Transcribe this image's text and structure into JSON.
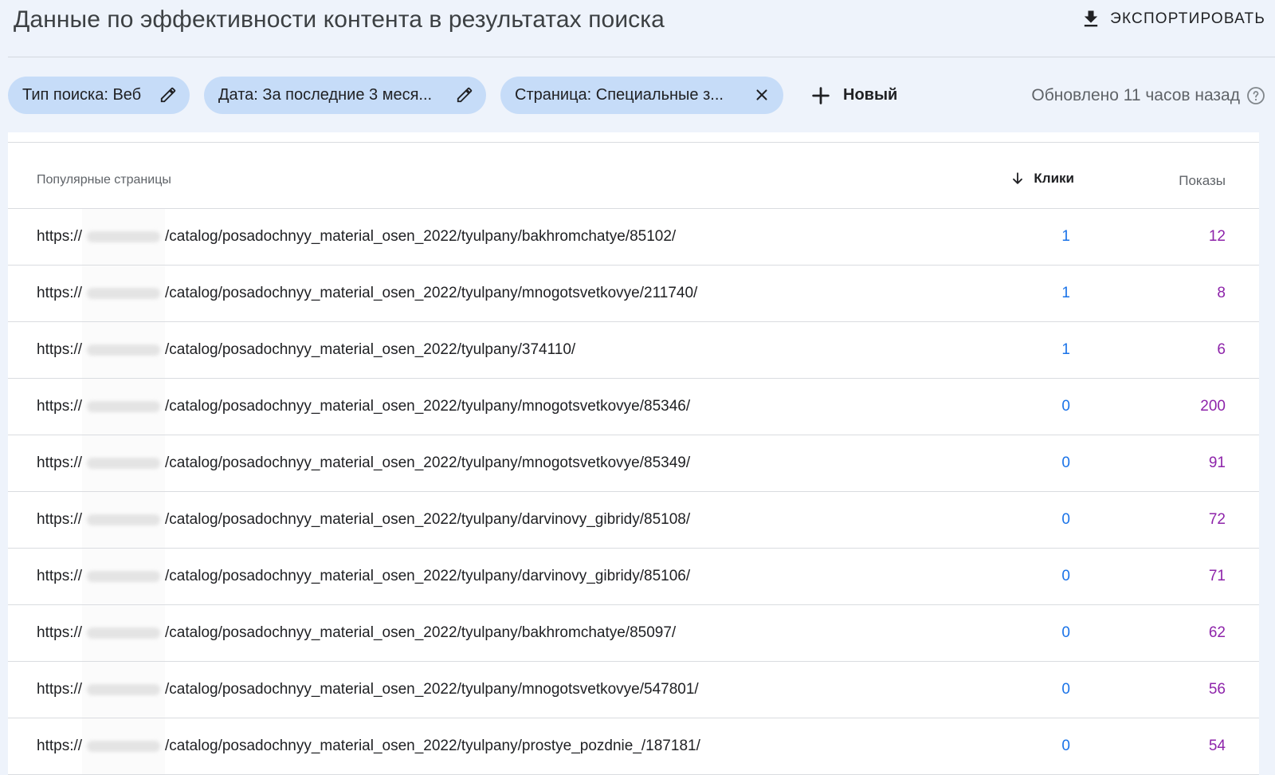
{
  "header": {
    "title": "Данные по эффективности контента в результатах поиска",
    "export_label": "ЭКСПОРТИРОВАТЬ"
  },
  "filters": {
    "chips": [
      {
        "label": "Тип поиска: Веб",
        "icon": "pencil-icon"
      },
      {
        "label": "Дата: За последние 3 меся...",
        "icon": "pencil-icon"
      },
      {
        "label": "Страница: Специальные з...",
        "icon": "close-icon"
      }
    ],
    "new_label": "Новый",
    "updated_text": "Обновлено 11 часов назад"
  },
  "table": {
    "headers": {
      "page": "Популярные страницы",
      "clicks": "Клики",
      "impressions": "Показы"
    },
    "rows": [
      {
        "prefix": "https://",
        "path": "/catalog/posadochnyy_material_osen_2022/tyulpany/bakhromchatye/85102/",
        "clicks": "1",
        "impressions": "12"
      },
      {
        "prefix": "https://",
        "path": "/catalog/posadochnyy_material_osen_2022/tyulpany/mnogotsvetkovye/211740/",
        "clicks": "1",
        "impressions": "8"
      },
      {
        "prefix": "https://",
        "path": "/catalog/posadochnyy_material_osen_2022/tyulpany/374110/",
        "clicks": "1",
        "impressions": "6"
      },
      {
        "prefix": "https://",
        "path": "/catalog/posadochnyy_material_osen_2022/tyulpany/mnogotsvetkovye/85346/",
        "clicks": "0",
        "impressions": "200"
      },
      {
        "prefix": "https://",
        "path": "/catalog/posadochnyy_material_osen_2022/tyulpany/mnogotsvetkovye/85349/",
        "clicks": "0",
        "impressions": "91"
      },
      {
        "prefix": "https://",
        "path": "/catalog/posadochnyy_material_osen_2022/tyulpany/darvinovy_gibridy/85108/",
        "clicks": "0",
        "impressions": "72"
      },
      {
        "prefix": "https://",
        "path": "/catalog/posadochnyy_material_osen_2022/tyulpany/darvinovy_gibridy/85106/",
        "clicks": "0",
        "impressions": "71"
      },
      {
        "prefix": "https://",
        "path": "/catalog/posadochnyy_material_osen_2022/tyulpany/bakhromchatye/85097/",
        "clicks": "0",
        "impressions": "62"
      },
      {
        "prefix": "https://",
        "path": "/catalog/posadochnyy_material_osen_2022/tyulpany/mnogotsvetkovye/547801/",
        "clicks": "0",
        "impressions": "56"
      },
      {
        "prefix": "https://",
        "path": "/catalog/posadochnyy_material_osen_2022/tyulpany/prostye_pozdnie_/187181/",
        "clicks": "0",
        "impressions": "54"
      }
    ]
  },
  "colors": {
    "clicks": "#1a73e8",
    "impressions": "#8e24aa",
    "chip_bg": "#c6dcf8",
    "page_bg": "#eef3fb"
  }
}
